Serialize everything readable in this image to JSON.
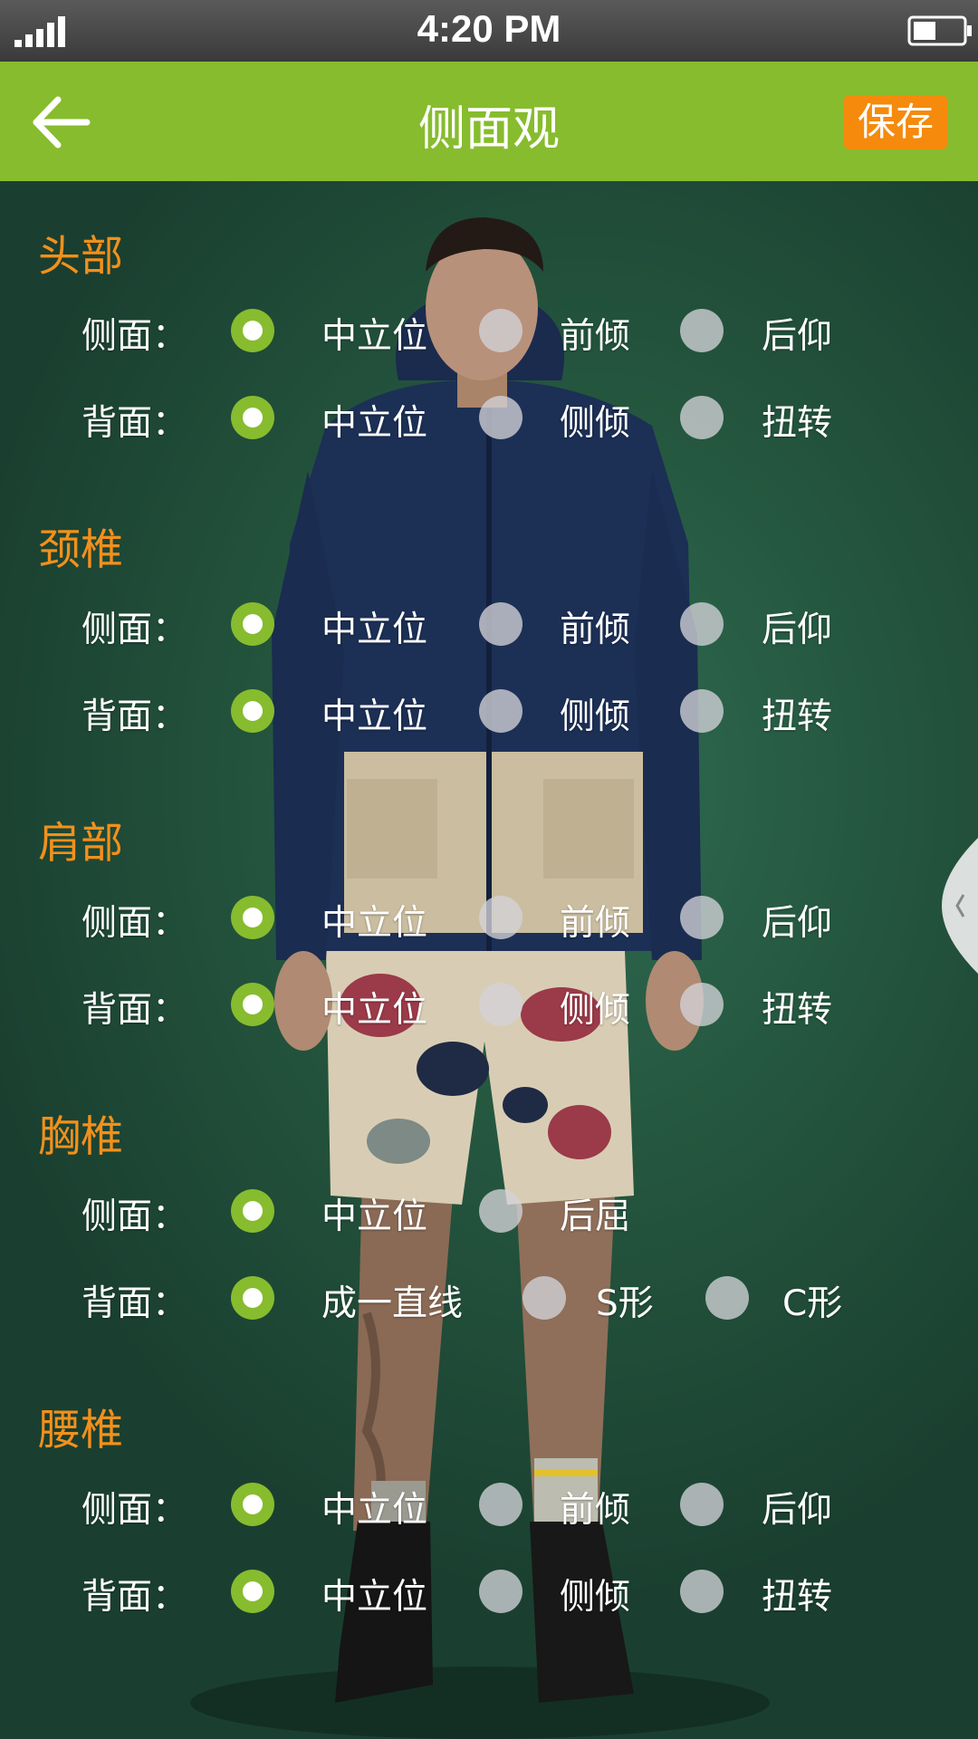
{
  "status_bar": {
    "time": "4:20 PM",
    "signal_icon": "signal-bars-icon",
    "battery_icon": "battery-icon"
  },
  "nav": {
    "back_icon": "arrow-left-icon",
    "title": "侧面观",
    "save_label": "保存"
  },
  "colors": {
    "accent": "#87bc2e",
    "section_title": "#f3901b",
    "save_button": "#f58a0c"
  },
  "sections": [
    {
      "title": "头部",
      "rows": [
        {
          "label": "侧面：",
          "options": [
            "中立位",
            "前倾",
            "后仰"
          ],
          "selected": 0
        },
        {
          "label": "背面：",
          "options": [
            "中立位",
            "侧倾",
            "扭转"
          ],
          "selected": 0
        }
      ]
    },
    {
      "title": "颈椎",
      "rows": [
        {
          "label": "侧面：",
          "options": [
            "中立位",
            "前倾",
            "后仰"
          ],
          "selected": 0
        },
        {
          "label": "背面：",
          "options": [
            "中立位",
            "侧倾",
            "扭转"
          ],
          "selected": 0
        }
      ]
    },
    {
      "title": "肩部",
      "rows": [
        {
          "label": "侧面：",
          "options": [
            "中立位",
            "前倾",
            "后仰"
          ],
          "selected": 0
        },
        {
          "label": "背面：",
          "options": [
            "中立位",
            "侧倾",
            "扭转"
          ],
          "selected": 0
        }
      ]
    },
    {
      "title": "胸椎",
      "rows": [
        {
          "label": "侧面：",
          "options": [
            "中立位",
            "后屈"
          ],
          "selected": 0
        },
        {
          "label": "背面：",
          "options": [
            "成一直线",
            "S形",
            "C形"
          ],
          "selected": 0
        }
      ]
    },
    {
      "title": "腰椎",
      "rows": [
        {
          "label": "侧面：",
          "options": [
            "中立位",
            "前倾",
            "后仰"
          ],
          "selected": 0
        },
        {
          "label": "背面：",
          "options": [
            "中立位",
            "侧倾",
            "扭转"
          ],
          "selected": 0
        }
      ]
    }
  ],
  "drawer_handle_icon": "chevron-left-icon"
}
